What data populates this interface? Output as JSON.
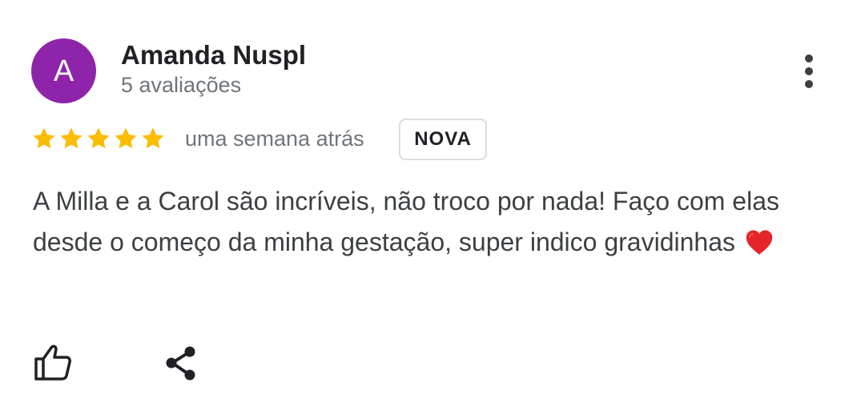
{
  "author": {
    "initial": "A",
    "name": "Amanda Nuspl",
    "reviews_count_text": "5 avaliações",
    "avatar_color": "#8e24aa"
  },
  "rating": {
    "stars": 5,
    "max_stars": 5,
    "star_color": "#fbbc04"
  },
  "review": {
    "time": "uma semana atrás",
    "badge": "NOVA",
    "text": "A Milla e a Carol são incríveis, não troco por nada! Faço com elas desde o começo da minha gestação, super indico gravidinhas",
    "emoji": "heart"
  },
  "actions": {
    "like_icon": "thumbs-up-icon",
    "share_icon": "share-icon",
    "more_icon": "more-vert-icon"
  }
}
